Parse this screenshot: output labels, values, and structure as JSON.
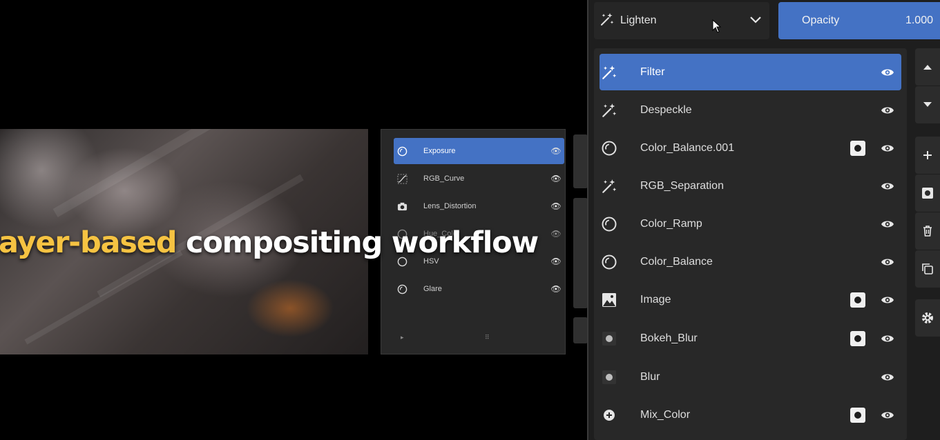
{
  "caption": {
    "highlight": "ayer-based",
    "rest": " compositing workflow"
  },
  "small_panel": {
    "items": [
      {
        "label": "Exposure",
        "icon": "color-balance-icon",
        "active": true
      },
      {
        "label": "RGB_Curve",
        "icon": "curve-icon",
        "active": false
      },
      {
        "label": "Lens_Distortion",
        "icon": "camera-icon",
        "active": false
      },
      {
        "label": "Hue_Color",
        "icon": "color-balance-icon",
        "active": false
      },
      {
        "label": "HSV",
        "icon": "color-balance-icon",
        "active": false
      },
      {
        "label": "Glare",
        "icon": "color-balance-icon",
        "active": false
      }
    ]
  },
  "blend": {
    "label": "Lighten",
    "icon": "magic-wand-icon"
  },
  "opacity": {
    "label": "Opacity",
    "value": "1.000"
  },
  "layers": [
    {
      "label": "Filter",
      "icon": "magic-wand-icon",
      "mask": false,
      "active": true
    },
    {
      "label": "Despeckle",
      "icon": "magic-wand-icon",
      "mask": false,
      "active": false
    },
    {
      "label": "Color_Balance.001",
      "icon": "color-balance-icon",
      "mask": true,
      "active": false
    },
    {
      "label": "RGB_Separation",
      "icon": "magic-wand-icon",
      "mask": false,
      "active": false
    },
    {
      "label": "Color_Ramp",
      "icon": "color-balance-icon",
      "mask": false,
      "active": false
    },
    {
      "label": "Color_Balance",
      "icon": "color-balance-icon",
      "mask": false,
      "active": false
    },
    {
      "label": "Image",
      "icon": "image-icon",
      "mask": true,
      "active": false
    },
    {
      "label": "Bokeh_Blur",
      "icon": "blur-icon",
      "mask": true,
      "active": false
    },
    {
      "label": "Blur",
      "icon": "blur-icon",
      "mask": false,
      "active": false
    },
    {
      "label": "Mix_Color",
      "icon": "mix-icon",
      "mask": true,
      "active": false
    }
  ],
  "colors": {
    "accent": "#4472c4",
    "highlight_text": "#f6c342",
    "panel_bg": "#282828"
  }
}
